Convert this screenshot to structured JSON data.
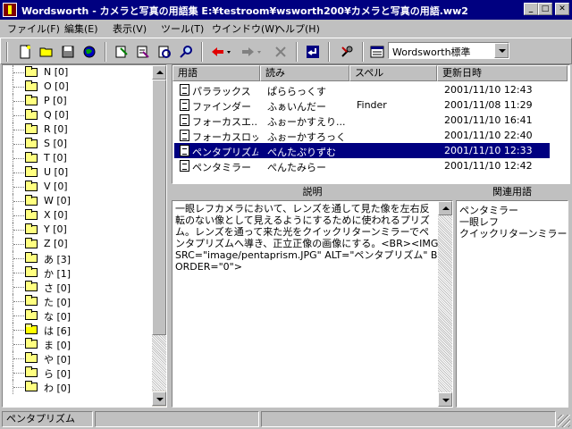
{
  "window": {
    "title": "Wordsworth - カメラと写真の用語集  E:¥testroom¥wsworth200¥カメラと写真の用語.ww2",
    "minimize": "_",
    "maximize": "□",
    "close": "✕"
  },
  "menu": [
    "ファイル(F)",
    "編集(E)",
    "表示(V)",
    "ツール(T)",
    "ウインドウ(W)",
    "ヘルプ(H)"
  ],
  "toolbar": {
    "combo_value": "Wordsworth標準",
    "icons": [
      "new-file-icon",
      "open-folder-icon",
      "save-icon",
      "globe-icon",
      "edit-add-icon",
      "edit-page-icon",
      "edit-refresh-icon",
      "search-icon",
      "back-arrow-icon",
      "forward-arrow-icon",
      "stop-icon",
      "return-icon",
      "tools-icon",
      "view-icon"
    ]
  },
  "tree": [
    {
      "label": "N  [0]"
    },
    {
      "label": "O  [0]"
    },
    {
      "label": "P  [0]"
    },
    {
      "label": "Q  [0]"
    },
    {
      "label": "R  [0]"
    },
    {
      "label": "S  [0]"
    },
    {
      "label": "T  [0]"
    },
    {
      "label": "U  [0]"
    },
    {
      "label": "V  [0]"
    },
    {
      "label": "W  [0]"
    },
    {
      "label": "X  [0]"
    },
    {
      "label": "Y  [0]"
    },
    {
      "label": "Z  [0]"
    },
    {
      "label": "あ  [3]"
    },
    {
      "label": "か  [1]"
    },
    {
      "label": "さ  [0]"
    },
    {
      "label": "た  [0]"
    },
    {
      "label": "な  [0]"
    },
    {
      "label": "は  [6]",
      "open": true
    },
    {
      "label": "ま  [0]"
    },
    {
      "label": "や  [0]"
    },
    {
      "label": "ら  [0]"
    },
    {
      "label": "わ  [0]"
    }
  ],
  "list": {
    "columns": [
      "用語",
      "読み",
      "スペル",
      "更新日時"
    ],
    "rows": [
      {
        "term": "パララックス",
        "reading": "ぱららっくす",
        "spell": "",
        "date": "2001/11/10 12:43"
      },
      {
        "term": "ファインダー",
        "reading": "ふぁいんだー",
        "spell": "Finder",
        "date": "2001/11/08 11:29"
      },
      {
        "term": "フォーカスエ...",
        "reading": "ふぉーかすえり...",
        "spell": "",
        "date": "2001/11/10 16:41"
      },
      {
        "term": "フォーカスロッ...",
        "reading": "ふぉーかすろっく",
        "spell": "",
        "date": "2001/11/10 22:40"
      },
      {
        "term": "ペンタプリズム",
        "reading": "ぺんたぷりずむ",
        "spell": "",
        "date": "2001/11/10 12:33",
        "selected": true
      },
      {
        "term": "ペンタミラー",
        "reading": "ぺんたみらー",
        "spell": "",
        "date": "2001/11/10 12:42"
      }
    ]
  },
  "description": {
    "header": "説明",
    "text": "一眼レフカメラにおいて、レンズを通して見た像を左右反転のない像として見えるようにするために使われるプリズム。レンズを通って来た光をクイックリターンミラーでペンタプリズムへ導き、正立正像の画像にする。<BR><IMG SRC=\"image/pentaprism.JPG\" ALT=\"ペンタプリズム\" BORDER=\"0\">"
  },
  "related": {
    "header": "関連用語",
    "items": [
      "ペンタミラー",
      "一眼レフ",
      "クイックリターンミラー"
    ]
  },
  "status": {
    "text": "ペンタプリズム"
  }
}
